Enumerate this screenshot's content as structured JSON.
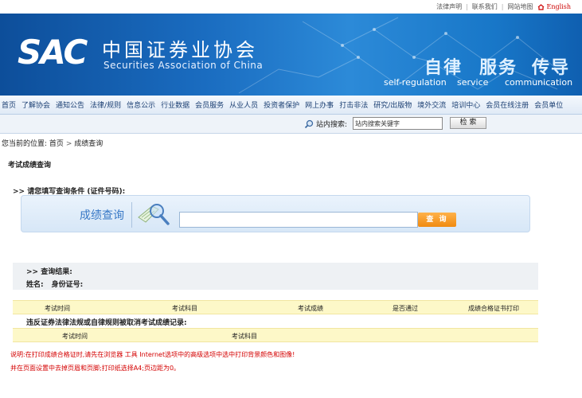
{
  "top_links": [
    "法律声明",
    "联系我们",
    "网站地图"
  ],
  "lang_link": "English",
  "logo": {
    "abbr": "SAC",
    "cn": "中国证券业协会",
    "en": "Securities Association of China"
  },
  "slogans": [
    {
      "cn": "自律",
      "en": "self-regulation"
    },
    {
      "cn": "服务",
      "en": "service"
    },
    {
      "cn": "传导",
      "en": "communication"
    }
  ],
  "nav": [
    "首页",
    "了解协会",
    "通知公告",
    "法律/规则",
    "信息公示",
    "行业数据",
    "会员服务",
    "从业人员",
    "投资者保护",
    "网上办事",
    "打击非法",
    "研究/出版物",
    "境外交流",
    "培训中心",
    "会员在线注册",
    "会员单位"
  ],
  "search": {
    "label": "站内搜索:",
    "value": "站内搜索关键字",
    "button": "检 索"
  },
  "breadcrumb": {
    "prefix": "您当前的位置:",
    "home": "首页",
    "current": "成绩查询"
  },
  "page_title": "考试成绩查询",
  "condition_label": ">> 请您填写查询条件 (证件号码):",
  "query": {
    "title": "成绩查询",
    "button": "查 询"
  },
  "result": {
    "header": ">> 查询结果:",
    "name_label": "姓名:",
    "id_label": "身份证号:"
  },
  "score_table": {
    "headers": [
      "考试时间",
      "考试科目",
      "考试成绩",
      "是否通过",
      "成绩合格证书打印"
    ]
  },
  "violation": {
    "title": "违反证券法律法规或自律规则被取消考试成绩记录:",
    "headers": [
      "考试时间",
      "考试科目"
    ]
  },
  "notes": [
    "说明:在打印成绩合格证时,请先在浏览器 工具 Internet选项中的高级选项中选中打印背景颜色和图像!",
    "并在页面设置中去掉页眉和页脚;打印纸选择A4;页边距为0。"
  ],
  "colors": {
    "banner": "#1a6cc0",
    "nav_text": "#1b3f73",
    "query_title": "#3778c6",
    "query_button": "#f08a10",
    "table_bg": "#fdf8c8",
    "note_text": "#d40000"
  }
}
